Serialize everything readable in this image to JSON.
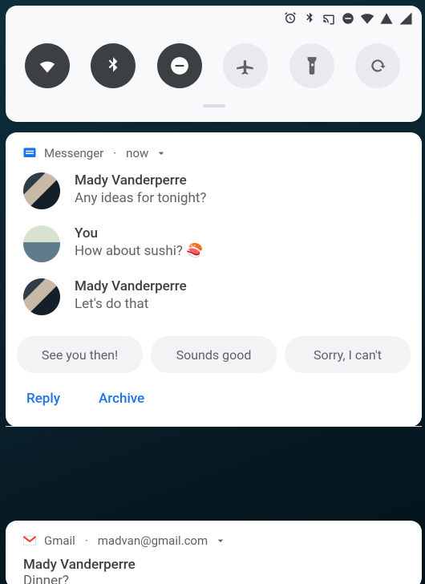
{
  "status_icons": [
    "alarm",
    "bluetooth",
    "cast",
    "dnd",
    "wifi",
    "battery",
    "signal"
  ],
  "quick_tiles": [
    {
      "name": "wifi",
      "on": true
    },
    {
      "name": "bluetooth",
      "on": true
    },
    {
      "name": "dnd",
      "on": true
    },
    {
      "name": "airplane",
      "on": false
    },
    {
      "name": "flashlight",
      "on": false
    },
    {
      "name": "rotate",
      "on": false
    }
  ],
  "messenger": {
    "app_name": "Messenger",
    "time": "now",
    "messages": [
      {
        "sender": "Mady Vanderperre",
        "text": "Any ideas for tonight?"
      },
      {
        "sender": "You",
        "text": "How about sushi? 🍣"
      },
      {
        "sender": "Mady Vanderperre",
        "text": "Let's do that"
      }
    ],
    "suggestions": [
      "See you then!",
      "Sounds good",
      "Sorry, I can't"
    ],
    "actions": {
      "reply": "Reply",
      "archive": "Archive"
    }
  },
  "gmail": {
    "app_name": "Gmail",
    "account": "madvan@gmail.com",
    "sender": "Mady Vanderperre",
    "subject": "Dinner?"
  }
}
